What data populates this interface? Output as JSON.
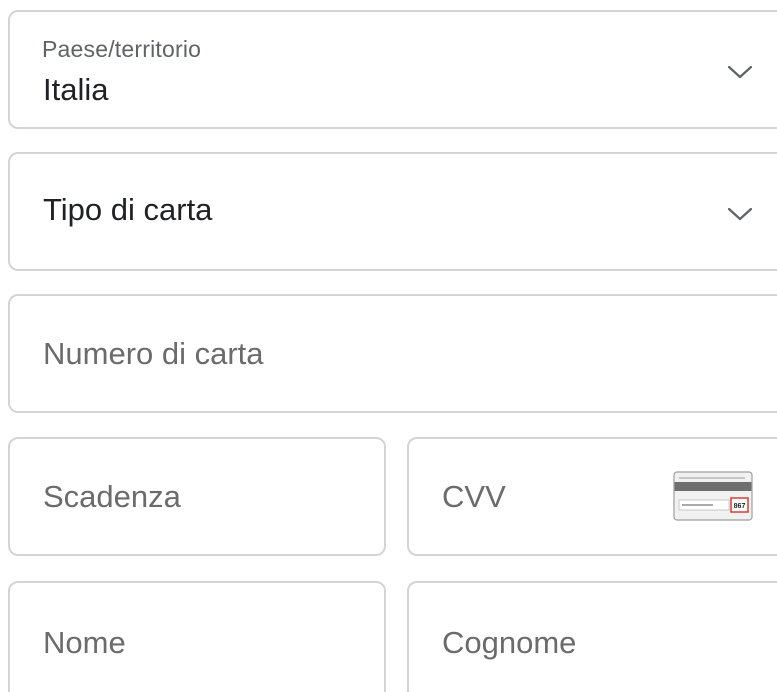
{
  "country": {
    "label": "Paese/territorio",
    "value": "Italia",
    "chevron_icon": "chevron-down-icon"
  },
  "card_type": {
    "value": "Tipo di carta",
    "chevron_icon": "chevron-down-icon"
  },
  "card_number": {
    "placeholder": "Numero di carta"
  },
  "expiry": {
    "placeholder": "Scadenza"
  },
  "cvv": {
    "placeholder": "CVV",
    "hint_icon": "card-back-cvv-icon",
    "hint_code": "867"
  },
  "first_name": {
    "placeholder": "Nome"
  },
  "last_name": {
    "placeholder": "Cognome"
  },
  "colors": {
    "border": "#d4d4d4",
    "text": "#202124",
    "label": "#5f6368",
    "placeholder": "#6b6b6b",
    "cvv_highlight": "#d93025"
  }
}
